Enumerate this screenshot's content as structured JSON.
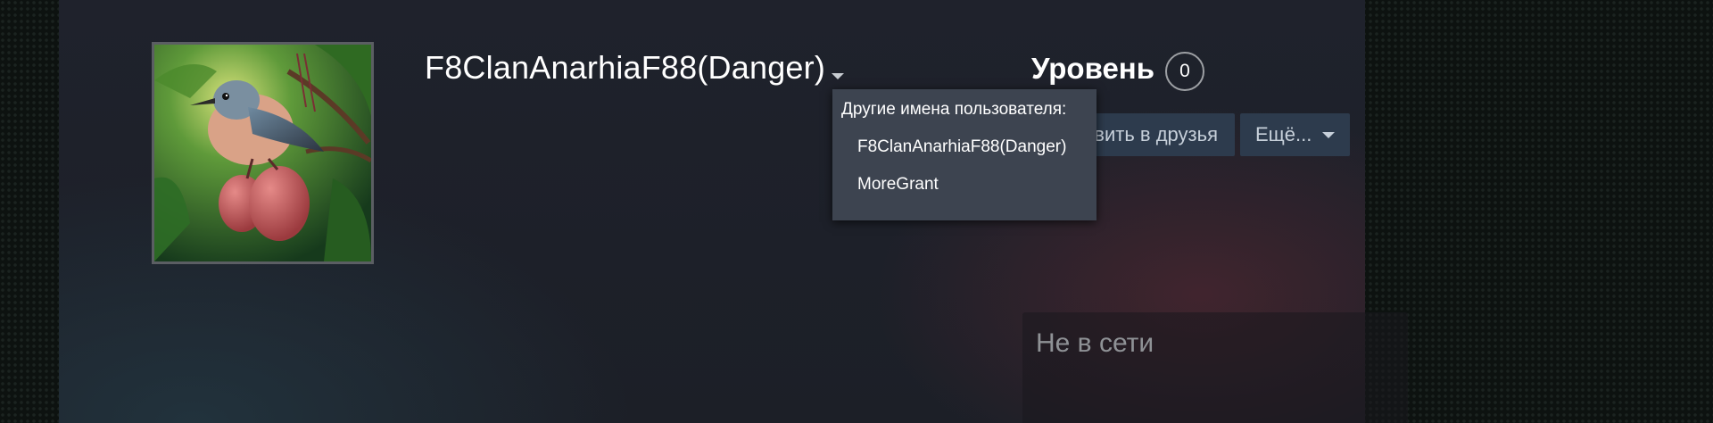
{
  "profile": {
    "persona_name": "F8ClanAnarhiaF88(Danger)",
    "avatar_icon": "avatar-bird-image",
    "name_history_toggle_icon": "caret-down-icon"
  },
  "level": {
    "label": "Уровень",
    "value": "0"
  },
  "actions": {
    "add_friend_label": "Добавить в друзья",
    "add_friend_visible_text": "вить в друзья",
    "more_label": "Ещё...",
    "more_icon": "caret-down-icon"
  },
  "name_history": {
    "title": "Другие имена пользователя:",
    "names": [
      "F8ClanAnarhiaF88(Danger)",
      "MoreGrant"
    ]
  },
  "status": {
    "text": "Не в сети"
  },
  "colors": {
    "panel_background": "#1f222c",
    "button_background": "#2d3b4d",
    "dropdown_background": "#3d4450",
    "status_text": "#8f9296"
  }
}
